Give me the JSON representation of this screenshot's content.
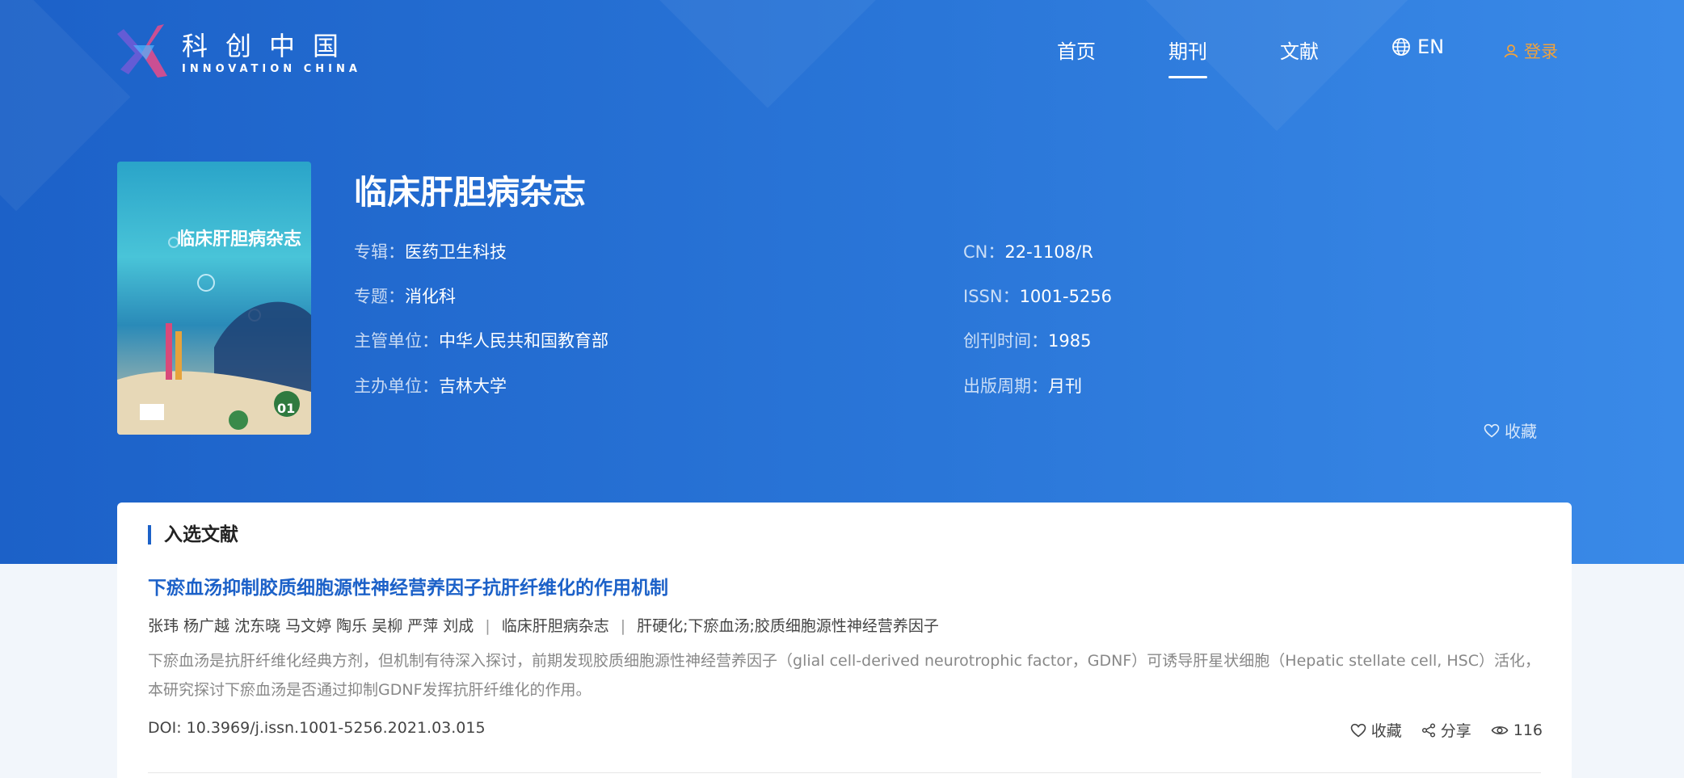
{
  "brand": {
    "cn": "科创中国",
    "en": "INNOVATION CHINA"
  },
  "nav": {
    "items": [
      {
        "label": "首页"
      },
      {
        "label": "期刊"
      },
      {
        "label": "文献"
      }
    ],
    "lang": "EN",
    "login": "登录",
    "accent_login": "#f0a23c"
  },
  "journal": {
    "title": "临床肝胆病杂志",
    "cover_text": "临床肝胆病杂志",
    "cover_issue": "01",
    "meta_left": [
      {
        "k": "专辑：",
        "v": "医药卫生科技"
      },
      {
        "k": "专题：",
        "v": "消化科"
      },
      {
        "k": "主管单位：",
        "v": "中华人民共和国教育部"
      },
      {
        "k": "主办单位：",
        "v": "吉林大学"
      }
    ],
    "meta_right": [
      {
        "k": "CN：",
        "v": "22-1108/R"
      },
      {
        "k": "ISSN：",
        "v": "1001-5256"
      },
      {
        "k": "创刊时间：",
        "v": "1985"
      },
      {
        "k": "出版周期：",
        "v": "月刊"
      }
    ],
    "favorite": "收藏"
  },
  "section": {
    "title": "入选文献",
    "article": {
      "title": "下瘀血汤抑制胶质细胞源性神经营养因子抗肝纤维化的作用机制",
      "authors": "张玮 杨广越 沈东晓 马文婷 陶乐 吴柳 严萍 刘成",
      "journal": "临床肝胆病杂志",
      "keywords": "肝硬化;下瘀血汤;胶质细胞源性神经营养因子",
      "abstract": "下瘀血汤是抗肝纤维化经典方剂，但机制有待深入探讨，前期发现胶质细胞源性神经营养因子（glial cell-derived neurotrophic factor，GDNF）可诱导肝星状细胞（Hepatic stellate cell, HSC）活化，本研究探讨下瘀血汤是否通过抑制GDNF发挥抗肝纤维化的作用。",
      "doi": "DOI: 10.3969/j.issn.1001-5256.2021.03.015",
      "favorite": "收藏",
      "share": "分享",
      "views": "116"
    }
  },
  "colors": {
    "primary": "#1c61c8",
    "hero_end": "#3a8ae8"
  }
}
